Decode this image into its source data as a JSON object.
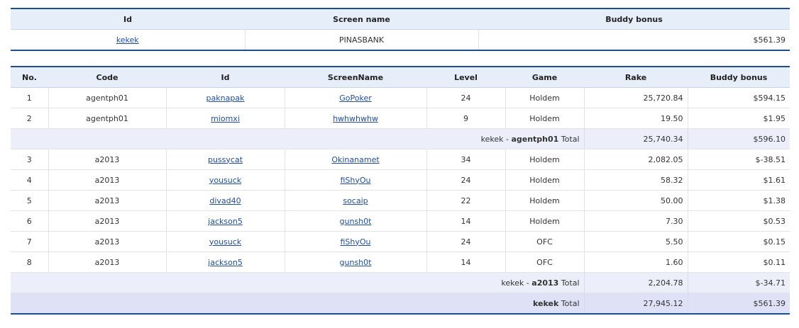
{
  "summary": {
    "headers": {
      "id": "Id",
      "screen_name": "Screen name",
      "buddy_bonus": "Buddy bonus"
    },
    "row": {
      "id": "kekek",
      "screen_name": "PINASBANK",
      "buddy_bonus": "$561.39"
    }
  },
  "detail": {
    "headers": {
      "no": "No.",
      "code": "Code",
      "id": "Id",
      "screen_name": "ScreenName",
      "level": "Level",
      "game": "Game",
      "rake": "Rake",
      "buddy_bonus": "Buddy bonus"
    },
    "rows": [
      {
        "no": "1",
        "code": "agentph01",
        "id": "paknapak",
        "screen_name": "GoPoker",
        "level": "24",
        "game": "Holdem",
        "rake": "25,720.84",
        "buddy_bonus": "$594.15"
      },
      {
        "no": "2",
        "code": "agentph01",
        "id": "miomxi",
        "screen_name": "hwhwhwhw",
        "level": "9",
        "game": "Holdem",
        "rake": "19.50",
        "buddy_bonus": "$1.95"
      },
      {
        "no": "3",
        "code": "a2013",
        "id": "pussycat",
        "screen_name": "Okinanamet",
        "level": "34",
        "game": "Holdem",
        "rake": "2,082.05",
        "buddy_bonus": "$-38.51"
      },
      {
        "no": "4",
        "code": "a2013",
        "id": "yousuck",
        "screen_name": "fiShyOu",
        "level": "24",
        "game": "Holdem",
        "rake": "58.32",
        "buddy_bonus": "$1.61"
      },
      {
        "no": "5",
        "code": "a2013",
        "id": "divad40",
        "screen_name": "socaip",
        "level": "22",
        "game": "Holdem",
        "rake": "50.00",
        "buddy_bonus": "$1.38"
      },
      {
        "no": "6",
        "code": "a2013",
        "id": "jackson5",
        "screen_name": "gunsh0t",
        "level": "14",
        "game": "Holdem",
        "rake": "7.30",
        "buddy_bonus": "$0.53"
      },
      {
        "no": "7",
        "code": "a2013",
        "id": "yousuck",
        "screen_name": "fiShyOu",
        "level": "24",
        "game": "OFC",
        "rake": "5.50",
        "buddy_bonus": "$0.15"
      },
      {
        "no": "8",
        "code": "a2013",
        "id": "jackson5",
        "screen_name": "gunsh0t",
        "level": "14",
        "game": "OFC",
        "rake": "1.60",
        "buddy_bonus": "$0.11"
      }
    ],
    "subtotal_agentph01": {
      "owner": "kekek",
      "sep": " - ",
      "code": "agentph01",
      "suffix": " Total",
      "rake": "25,740.34",
      "buddy_bonus": "$596.10"
    },
    "subtotal_a2013": {
      "owner": "kekek",
      "sep": " - ",
      "code": "a2013",
      "suffix": " Total",
      "rake": "2,204.78",
      "buddy_bonus": "$-34.71"
    },
    "grand_total": {
      "owner": "kekek",
      "suffix": " Total",
      "rake": "27,945.12",
      "buddy_bonus": "$561.39"
    }
  }
}
